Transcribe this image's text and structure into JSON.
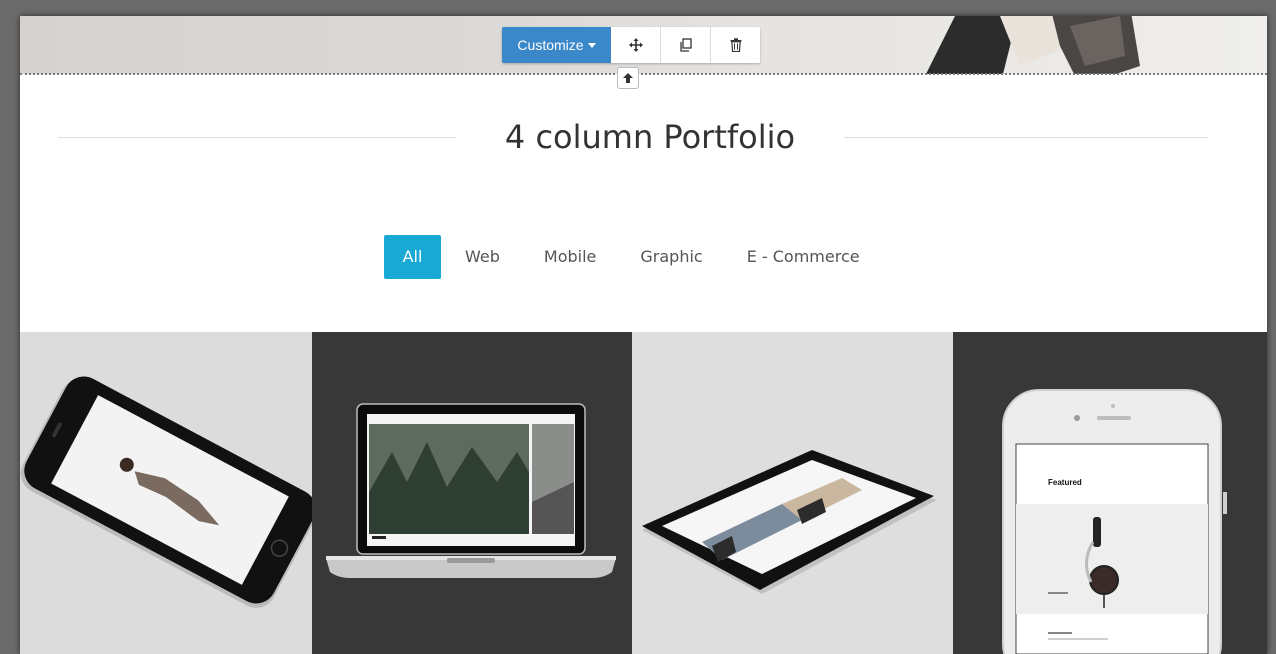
{
  "toolbar": {
    "customize_label": "Customize",
    "icons": [
      "move-icon",
      "duplicate-icon",
      "trash-icon"
    ]
  },
  "section": {
    "title": "4 column Portfolio"
  },
  "filters": [
    {
      "label": "All",
      "active": true
    },
    {
      "label": "Web",
      "active": false
    },
    {
      "label": "Mobile",
      "active": false
    },
    {
      "label": "Graphic",
      "active": false
    },
    {
      "label": "E - Commerce",
      "active": false
    }
  ],
  "portfolio": {
    "items": [
      {
        "depicts": "smartphone-mockup"
      },
      {
        "depicts": "laptop-mockup"
      },
      {
        "depicts": "tablet-mockup"
      },
      {
        "depicts": "iphone-mockup",
        "screen_heading": "Featured"
      }
    ]
  },
  "colors": {
    "customize_button": "#3a87c9",
    "active_filter": "#19a9d5",
    "dark_tile": "#383838",
    "light_tile": "#dcdcdc"
  }
}
